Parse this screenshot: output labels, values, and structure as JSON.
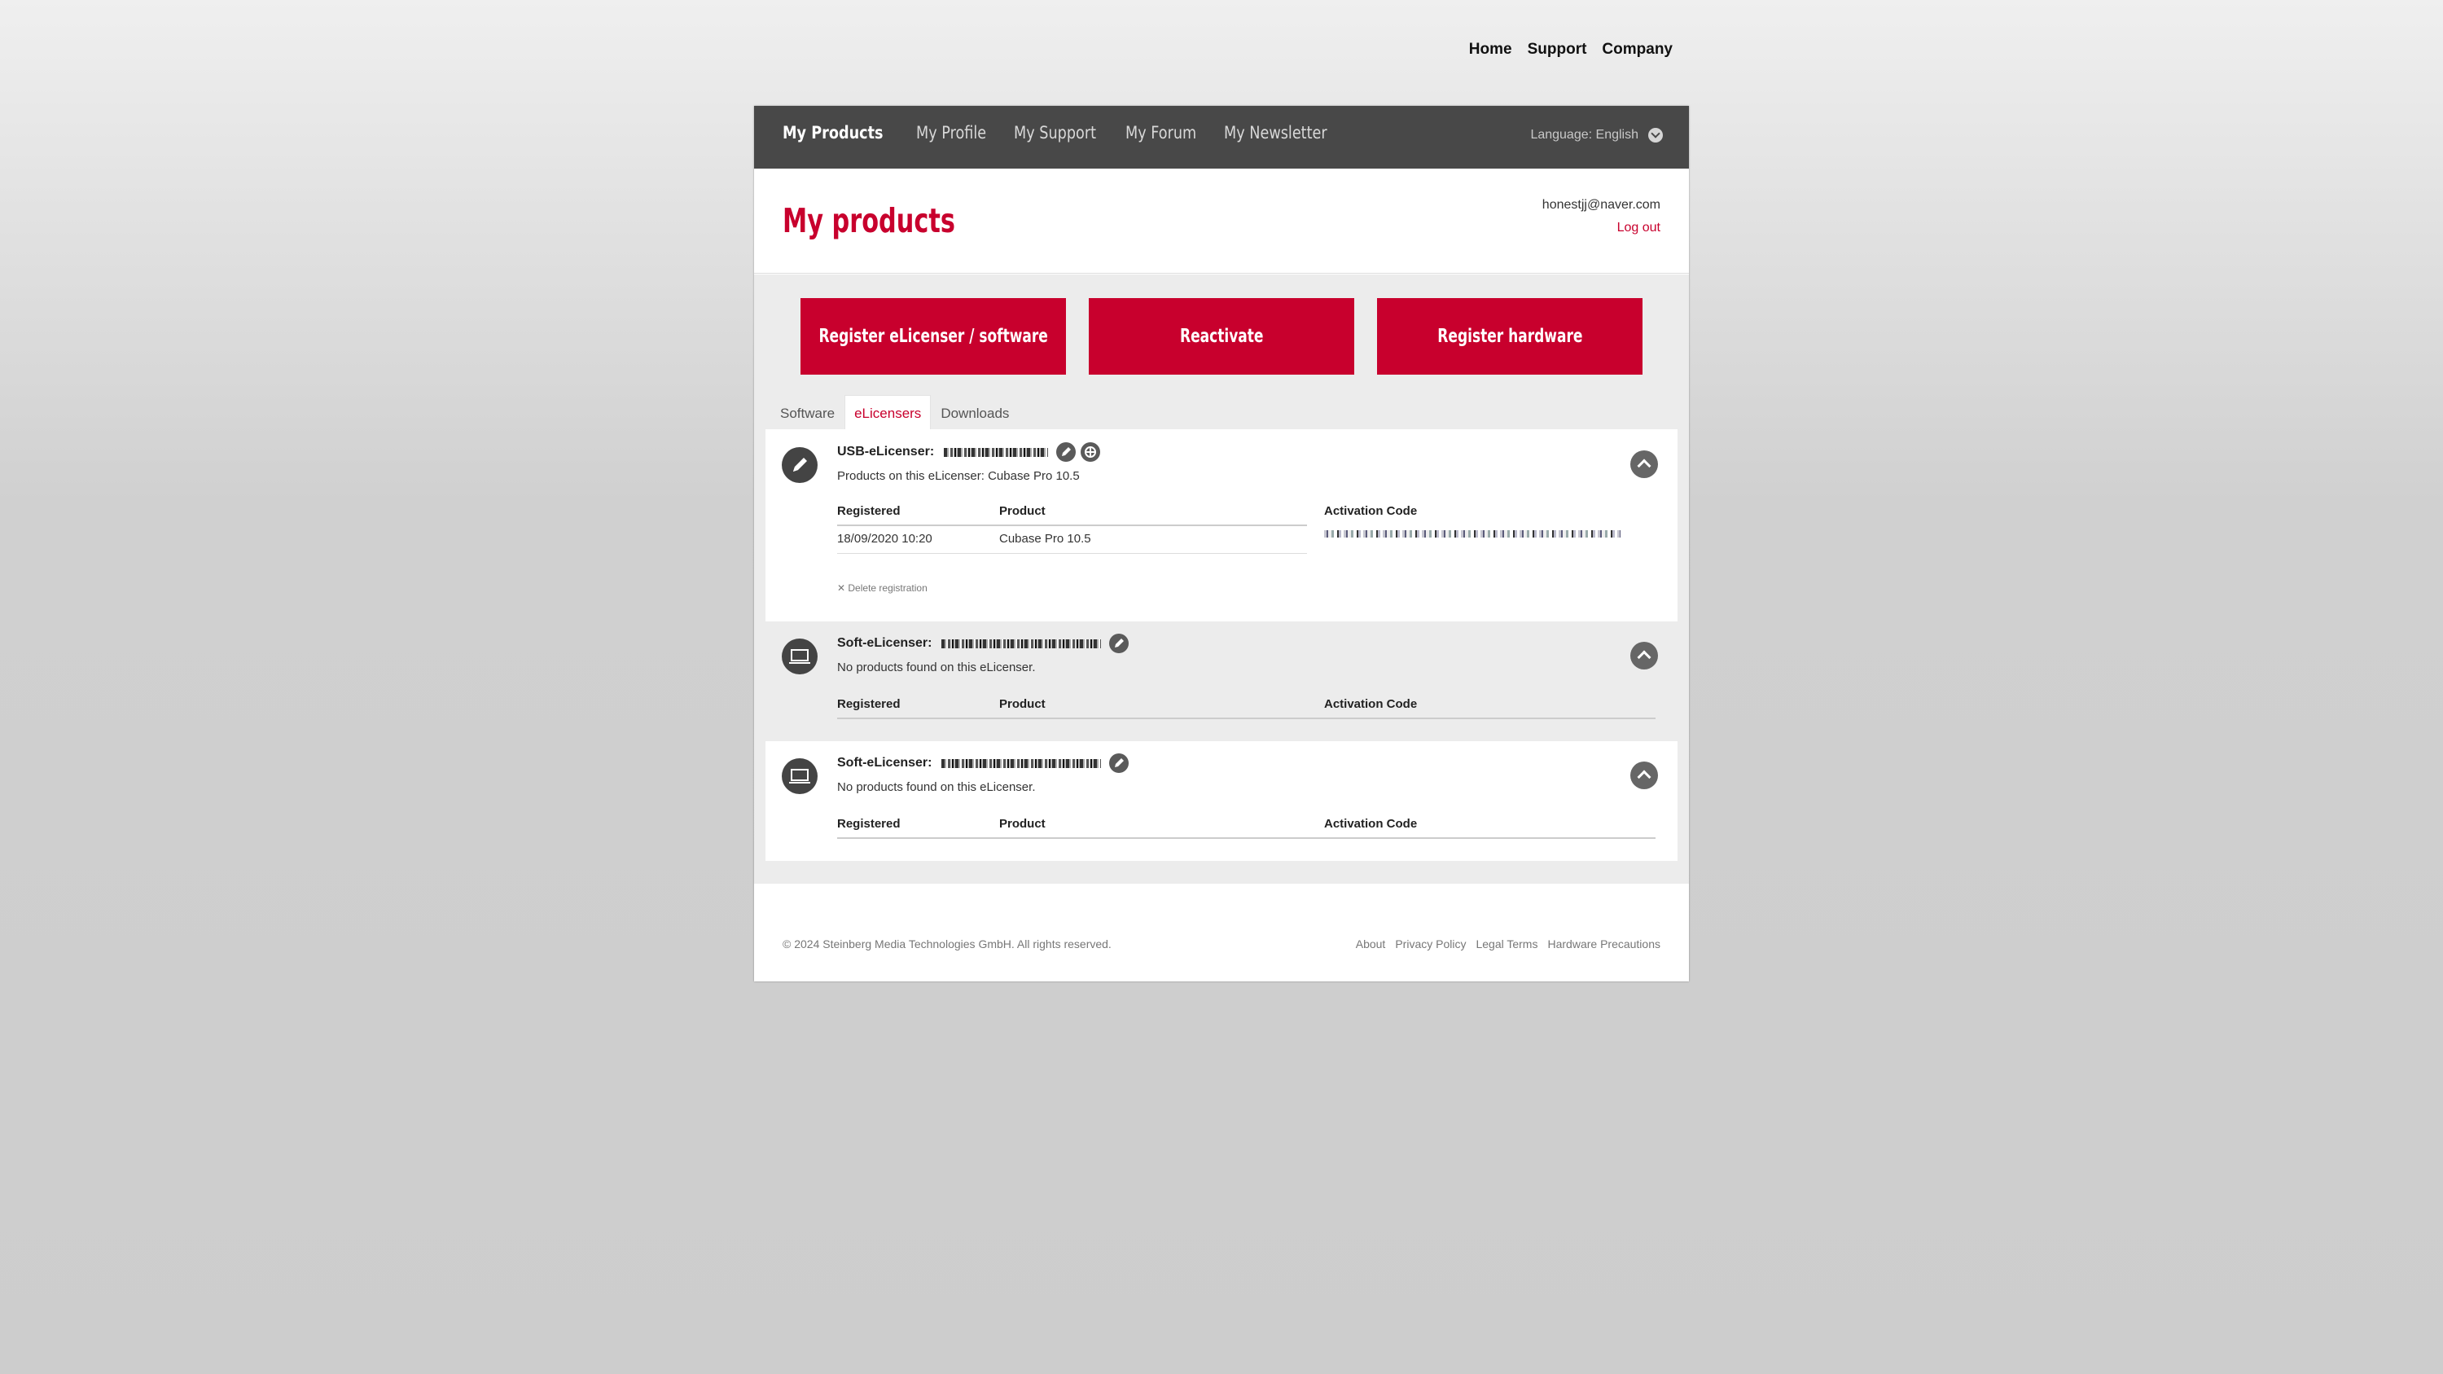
{
  "top_nav": [
    "Home",
    "Support",
    "Company"
  ],
  "nav_tabs": [
    "My Products",
    "My Profile",
    "My Support",
    "My Forum",
    "My Newsletter"
  ],
  "language": "Language: English",
  "page_title": "My products",
  "user": {
    "email": "honestjj@naver.com",
    "logout": "Log out"
  },
  "actions": [
    "Register eLicenser / software",
    "Reactivate",
    "Register hardware"
  ],
  "subtabs": [
    "Software",
    "eLicensers",
    "Downloads"
  ],
  "columns": {
    "registered": "Registered",
    "product": "Product",
    "activation": "Activation Code"
  },
  "devices": [
    {
      "label": "USB-eLicenser:",
      "subtitle": "Products on this eLicenser: Cubase Pro 10.5",
      "rows": [
        {
          "registered": "18/09/2020 10:20",
          "product": "Cubase Pro 10.5"
        }
      ],
      "delete": "Delete registration"
    },
    {
      "label": "Soft-eLicenser:",
      "subtitle": "No products found on this eLicenser."
    },
    {
      "label": "Soft-eLicenser:",
      "subtitle": "No products found on this eLicenser."
    }
  ],
  "footer": {
    "copyright": "© 2024 Steinberg Media Technologies GmbH. All rights reserved.",
    "links": [
      "About",
      "Privacy Policy",
      "Legal Terms",
      "Hardware Precautions"
    ]
  },
  "colors": {
    "accent": "#c8002d",
    "navbar": "#484848"
  },
  "icons": [
    "pencil-icon",
    "laptop-icon",
    "edit-icon",
    "network-icon",
    "chevron-up-icon",
    "chevron-down-icon"
  ]
}
